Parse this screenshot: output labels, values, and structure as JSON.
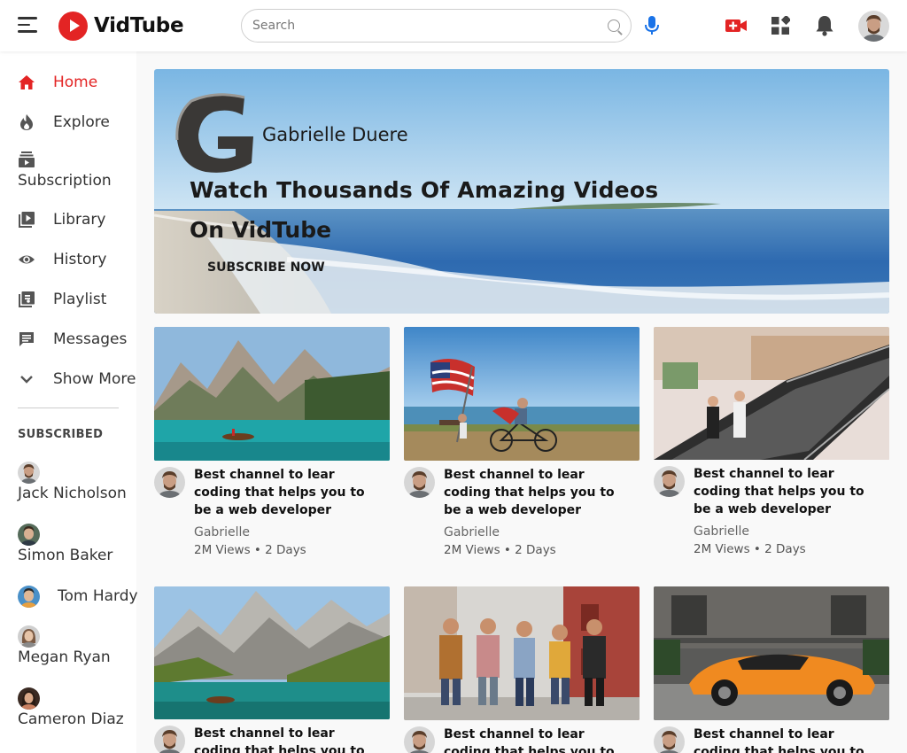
{
  "app": {
    "name": "VidTube"
  },
  "search": {
    "placeholder": "Search"
  },
  "header_icons": [
    "menu-icon",
    "mic-icon",
    "video-camera-icon",
    "apps-icon",
    "bell-icon",
    "avatar"
  ],
  "colors": {
    "accent": "#e32424",
    "sidebar_bg": "#ffffff",
    "content_bg": "#f9f9f9"
  },
  "sidebar": {
    "items": [
      {
        "label": "Home",
        "icon": "home-icon",
        "active": true
      },
      {
        "label": "Explore",
        "icon": "fire-icon"
      },
      {
        "label": "Subscription",
        "icon": "subscription-icon"
      },
      {
        "label": "Library",
        "icon": "library-icon"
      },
      {
        "label": "History",
        "icon": "eye-icon"
      },
      {
        "label": "Playlist",
        "icon": "playlist-icon"
      },
      {
        "label": "Messages",
        "icon": "chat-icon"
      },
      {
        "label": "Show More",
        "icon": "chevron-down-icon"
      }
    ],
    "subscribed_title": "SUBSCRIBED",
    "subscribed": [
      {
        "name": "Jack Nicholson"
      },
      {
        "name": "Simon Baker"
      },
      {
        "name": "Tom Hardy"
      },
      {
        "name": "Megan Ryan"
      },
      {
        "name": "Cameron Diaz"
      }
    ]
  },
  "banner": {
    "title": "Gabrielle Duere",
    "line1": "Watch Thousands Of Amazing Videos",
    "line2": "On VidTube",
    "cta": "SUBSCRIBE NOW"
  },
  "videos": [
    {
      "title": "Best channel to lear coding that helps you to be a web developer",
      "channel": "Gabrielle",
      "meta": "2M Views • 2 Days",
      "thumb": "lake-mountains-boat"
    },
    {
      "title": "Best channel to lear coding that helps you to be a web developer",
      "channel": "Gabrielle",
      "meta": "2M Views • 2 Days",
      "thumb": "beach-flag-bike"
    },
    {
      "title": "Best channel to lear coding that helps you to be a web developer",
      "channel": "Gabrielle",
      "meta": "2M Views • 2 Days",
      "thumb": "mall-escalator"
    },
    {
      "title": "Best channel to lear coding that helps you to be a web",
      "channel": "",
      "meta": "",
      "thumb": "alpine-lake-boat"
    },
    {
      "title": "Best channel to lear coding that helps you to be a web",
      "channel": "",
      "meta": "",
      "thumb": "friends-walking-street"
    },
    {
      "title": "Best channel to lear coding that helps you to be a web",
      "channel": "",
      "meta": "",
      "thumb": "orange-sports-car"
    }
  ]
}
